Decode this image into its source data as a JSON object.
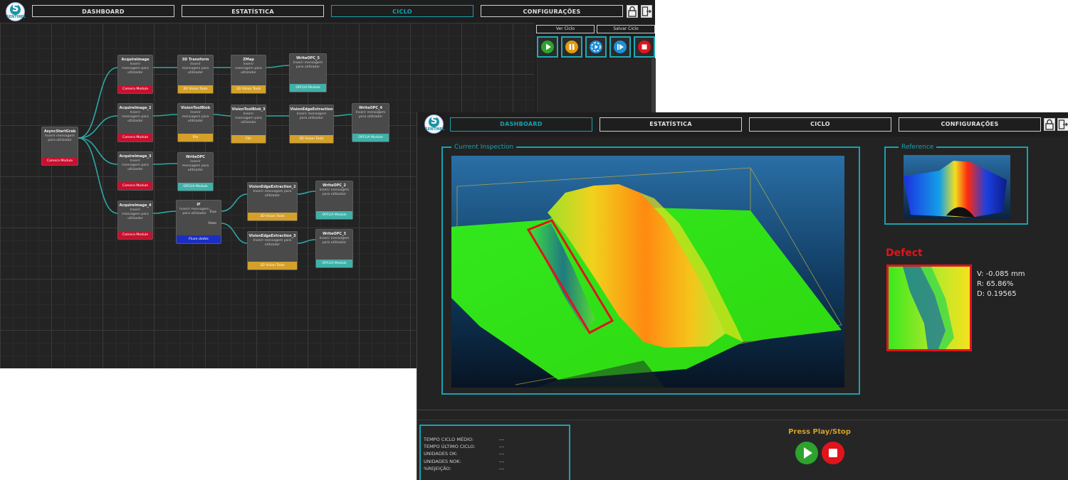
{
  "brand": {
    "logo_letter": "S",
    "logo_text": "SENTINEL"
  },
  "nav": {
    "tabs": [
      "DASHBOARD",
      "ESTATÍSTICA",
      "CICLO",
      "CONFIGURAÇÕES"
    ],
    "active_back": "CICLO",
    "active_front": "DASHBOARD"
  },
  "colors": {
    "accent": "#17a2b0",
    "camera": "#c8102e",
    "vision3d": "#d4a02a",
    "opcua": "#3fb1a8",
    "flow": "#1b2ec2",
    "defect": "#e1141c"
  },
  "cycle_panel": {
    "ver_ciclo": "Ver Ciclo",
    "salvar_ciclo": "Salvar Ciclo",
    "controls": [
      "play-icon",
      "pause-icon",
      "step-icon",
      "skip-icon",
      "stop-icon"
    ]
  },
  "nodes": [
    {
      "title": "AsyncStartGrab",
      "body": "Inserir mensagem para utilizador",
      "footer": "Camera Module"
    },
    {
      "title": "AcquireImage",
      "body": "Inserir mensagem para utilizador",
      "footer": "Camera Module"
    },
    {
      "title": "3D Transform",
      "body": "Inserir mensagem para utilizador",
      "footer": "3D Vision Tools"
    },
    {
      "title": "ZMap",
      "body": "Inserir mensagem para utilizador",
      "footer": "3D Vision Tools"
    },
    {
      "title": "WriteOPC_5",
      "body": "Inserir mensagem para utilizador",
      "footer": "OPCUA Module"
    },
    {
      "title": "AcquireImage_2",
      "body": "Inserir mensagem para utilizador",
      "footer": "Camera Module"
    },
    {
      "title": "VisionToolBlob",
      "body": "Inserir mensagem para utilizador",
      "footer": "File"
    },
    {
      "title": "VisionToolBlob_3",
      "body": "Inserir mensagem para utilizador",
      "footer": "File"
    },
    {
      "title": "VisionEdgeExtraction",
      "body": "Inserir mensagem para utilizador",
      "footer": "3D Vision Tools"
    },
    {
      "title": "WriteOPC_4",
      "body": "Inserir mensagem para utilizador",
      "footer": "OPCUA Module"
    },
    {
      "title": "AcquireImage_3",
      "body": "Inserir mensagem para utilizador",
      "footer": "Camera Module"
    },
    {
      "title": "WriteOPC",
      "body": "Inserir mensagem para utilizador",
      "footer": "OPCUA Module"
    },
    {
      "title": "AcquireImage_4",
      "body": "Inserir mensagem para utilizador",
      "footer": "Camera Module"
    },
    {
      "title": "IF",
      "body": "Inserir mensagem para utilizador",
      "footer": "Fluxo dados"
    },
    {
      "title": "VisionEdgeExtraction_2",
      "body": "Inserir mensagem para utilizador",
      "footer": "3D Vision Tools"
    },
    {
      "title": "WriteOPC_2",
      "body": "Inserir mensagem para utilizador",
      "footer": "OPCUA Module"
    },
    {
      "title": "VisionEdgeExtraction_3",
      "body": "Inserir mensagem para utilizador",
      "footer": "3D Vision Tools"
    },
    {
      "title": "WriteOPC_3",
      "body": "Inserir mensagem para utilizador",
      "footer": "OPCUA Module"
    }
  ],
  "if_ports": {
    "true_label": "True",
    "false_label": "False"
  },
  "dashboard": {
    "current_inspection": "Current Inspection",
    "reference": "Reference",
    "defect_title": "Defect",
    "defect_values": {
      "v": "V: -0.085 mm",
      "r": "R: 65.86%",
      "d": "D: 0.19565"
    },
    "stats": {
      "labels": [
        "TEMPO CICLO MÉDIO:",
        "TEMPO ÚLTIMO CICLO:",
        "UNIDADES OK:",
        "UNIDADES NOK:",
        "%REJEIÇÃO:"
      ],
      "values": [
        "---",
        "---",
        "---",
        "---",
        "---"
      ]
    },
    "press_play": "Press Play/Stop"
  }
}
